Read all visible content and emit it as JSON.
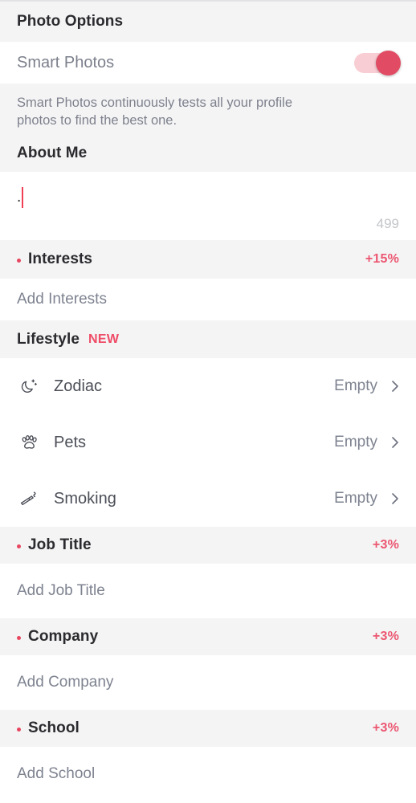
{
  "theme": {
    "accent_red": "#ec5670",
    "band_bg": "#f4f4f5",
    "row_bg": "#ffffff",
    "title_color": "#2b2b2f",
    "muted_color": "#7e8390"
  },
  "sections": {
    "photo_options": {
      "title": "Photo Options",
      "smart_photos": {
        "label": "Smart Photos",
        "toggle_state": "on",
        "description": "Smart Photos continuously tests all your profile photos to find the best one."
      }
    },
    "about_me": {
      "title": "About Me",
      "value": ".",
      "char_count": "499"
    },
    "interests": {
      "title": "Interests",
      "pct": "+15%",
      "placeholder": "Add Interests",
      "has_dot": true
    },
    "lifestyle": {
      "title": "Lifestyle",
      "badge": "NEW",
      "items": [
        {
          "icon": "moon-stars-icon",
          "label": "Zodiac",
          "value": "Empty"
        },
        {
          "icon": "paw-print-icon",
          "label": "Pets",
          "value": "Empty"
        },
        {
          "icon": "cigarette-icon",
          "label": "Smoking",
          "value": "Empty"
        }
      ]
    },
    "job_title": {
      "title": "Job Title",
      "pct": "+3%",
      "placeholder": "Add Job Title",
      "has_dot": true
    },
    "company": {
      "title": "Company",
      "pct": "+3%",
      "placeholder": "Add Company",
      "has_dot": true
    },
    "school": {
      "title": "School",
      "pct": "+3%",
      "placeholder": "Add School",
      "has_dot": true
    }
  }
}
